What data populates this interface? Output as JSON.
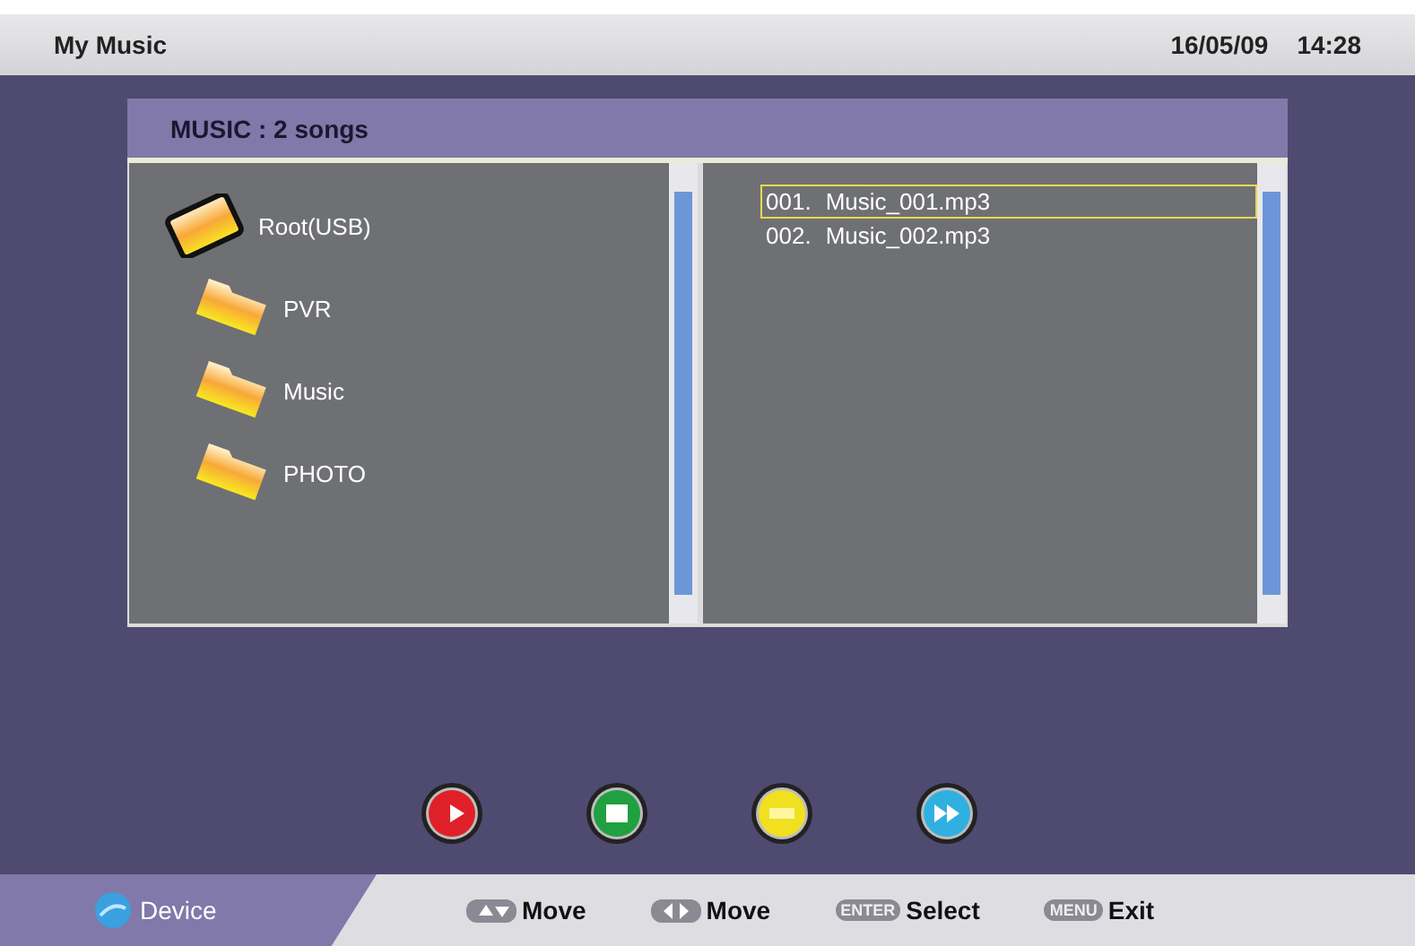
{
  "header": {
    "title": "My Music",
    "date": "16/05/09",
    "time": "14:28"
  },
  "panel_title": "MUSIC : 2 songs",
  "folders": [
    {
      "label": "Root(USB)",
      "kind": "root"
    },
    {
      "label": "PVR",
      "kind": "folder"
    },
    {
      "label": "Music",
      "kind": "folder"
    },
    {
      "label": "PHOTO",
      "kind": "folder"
    }
  ],
  "files": [
    {
      "number": "001.",
      "name": "Music_001.mp3",
      "selected": true
    },
    {
      "number": "002.",
      "name": "Music_002.mp3",
      "selected": false
    }
  ],
  "color_buttons": [
    {
      "kind": "play",
      "color": "#e02028"
    },
    {
      "kind": "stop",
      "color": "#20a040"
    },
    {
      "kind": "pause",
      "color": "#f0e020"
    },
    {
      "kind": "forward",
      "color": "#30b0e0"
    }
  ],
  "footer": {
    "device": "Device",
    "hints": [
      {
        "kind": "updown",
        "label": "Move"
      },
      {
        "kind": "leftright",
        "label": "Move"
      },
      {
        "kind": "text",
        "key": "ENTER",
        "label": "Select"
      },
      {
        "kind": "text",
        "key": "MENU",
        "label": "Exit"
      }
    ]
  }
}
